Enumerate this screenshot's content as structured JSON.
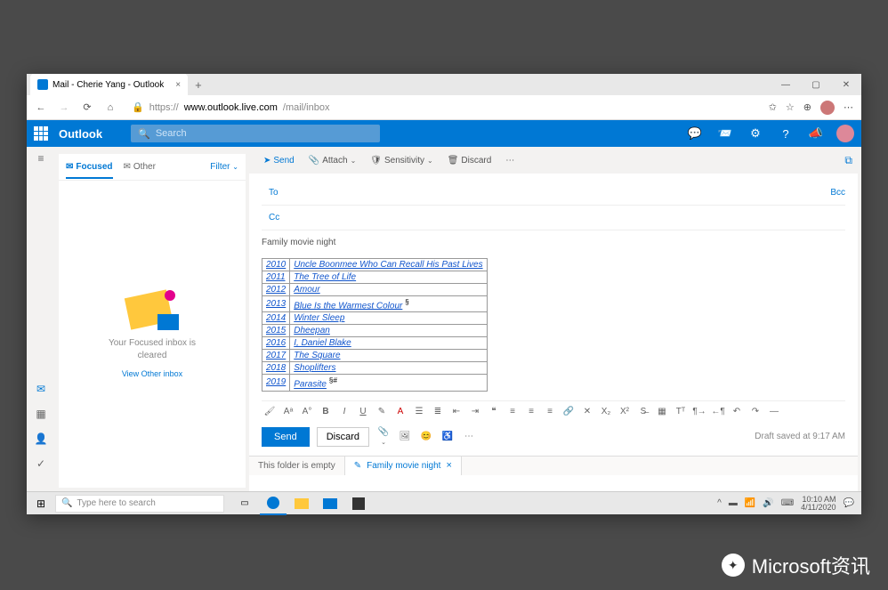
{
  "browser": {
    "tab_title": "Mail - Cherie Yang - Outlook",
    "url": "https://www.outlook.live.com/mail/inbox",
    "url_host": "www.outlook.live.com",
    "url_path": "/mail/inbox"
  },
  "header": {
    "brand": "Outlook",
    "search_placeholder": "Search"
  },
  "msglist": {
    "tab_focused": "Focused",
    "tab_other": "Other",
    "filter": "Filter",
    "empty_line1": "Your Focused inbox is",
    "empty_line2": "cleared",
    "empty_link": "View Other inbox"
  },
  "commands": {
    "send": "Send",
    "attach": "Attach",
    "sensitivity": "Sensitivity",
    "discard": "Discard"
  },
  "compose": {
    "to_label": "To",
    "cc_label": "Cc",
    "bcc_label": "Bcc",
    "subject": "Family movie night",
    "table_header_sup1": "§",
    "table_header_sup2": "§#",
    "rows": [
      {
        "year": "2010",
        "title": "Uncle Boonmee Who Can Recall His Past Lives"
      },
      {
        "year": "2011",
        "title": "The Tree of Life"
      },
      {
        "year": "2012",
        "title": "Amour"
      },
      {
        "year": "2013",
        "title": "Blue Is the Warmest Colour",
        "sup": "§"
      },
      {
        "year": "2014",
        "title": "Winter Sleep"
      },
      {
        "year": "2015",
        "title": "Dheepan"
      },
      {
        "year": "2016",
        "title": "I, Daniel Blake"
      },
      {
        "year": "2017",
        "title": "The Square"
      },
      {
        "year": "2018",
        "title": "Shoplifters"
      },
      {
        "year": "2019",
        "title": "Parasite",
        "sup": "§#"
      }
    ],
    "send_btn": "Send",
    "discard_btn": "Discard",
    "draft_status": "Draft saved at 9:17 AM"
  },
  "bottom_tabs": {
    "empty": "This folder is empty",
    "draft": "Family movie night"
  },
  "taskbar": {
    "search_placeholder": "Type here to search",
    "time": "10:10 AM",
    "date": "4/11/2020"
  },
  "watermark": "Microsoft资讯"
}
